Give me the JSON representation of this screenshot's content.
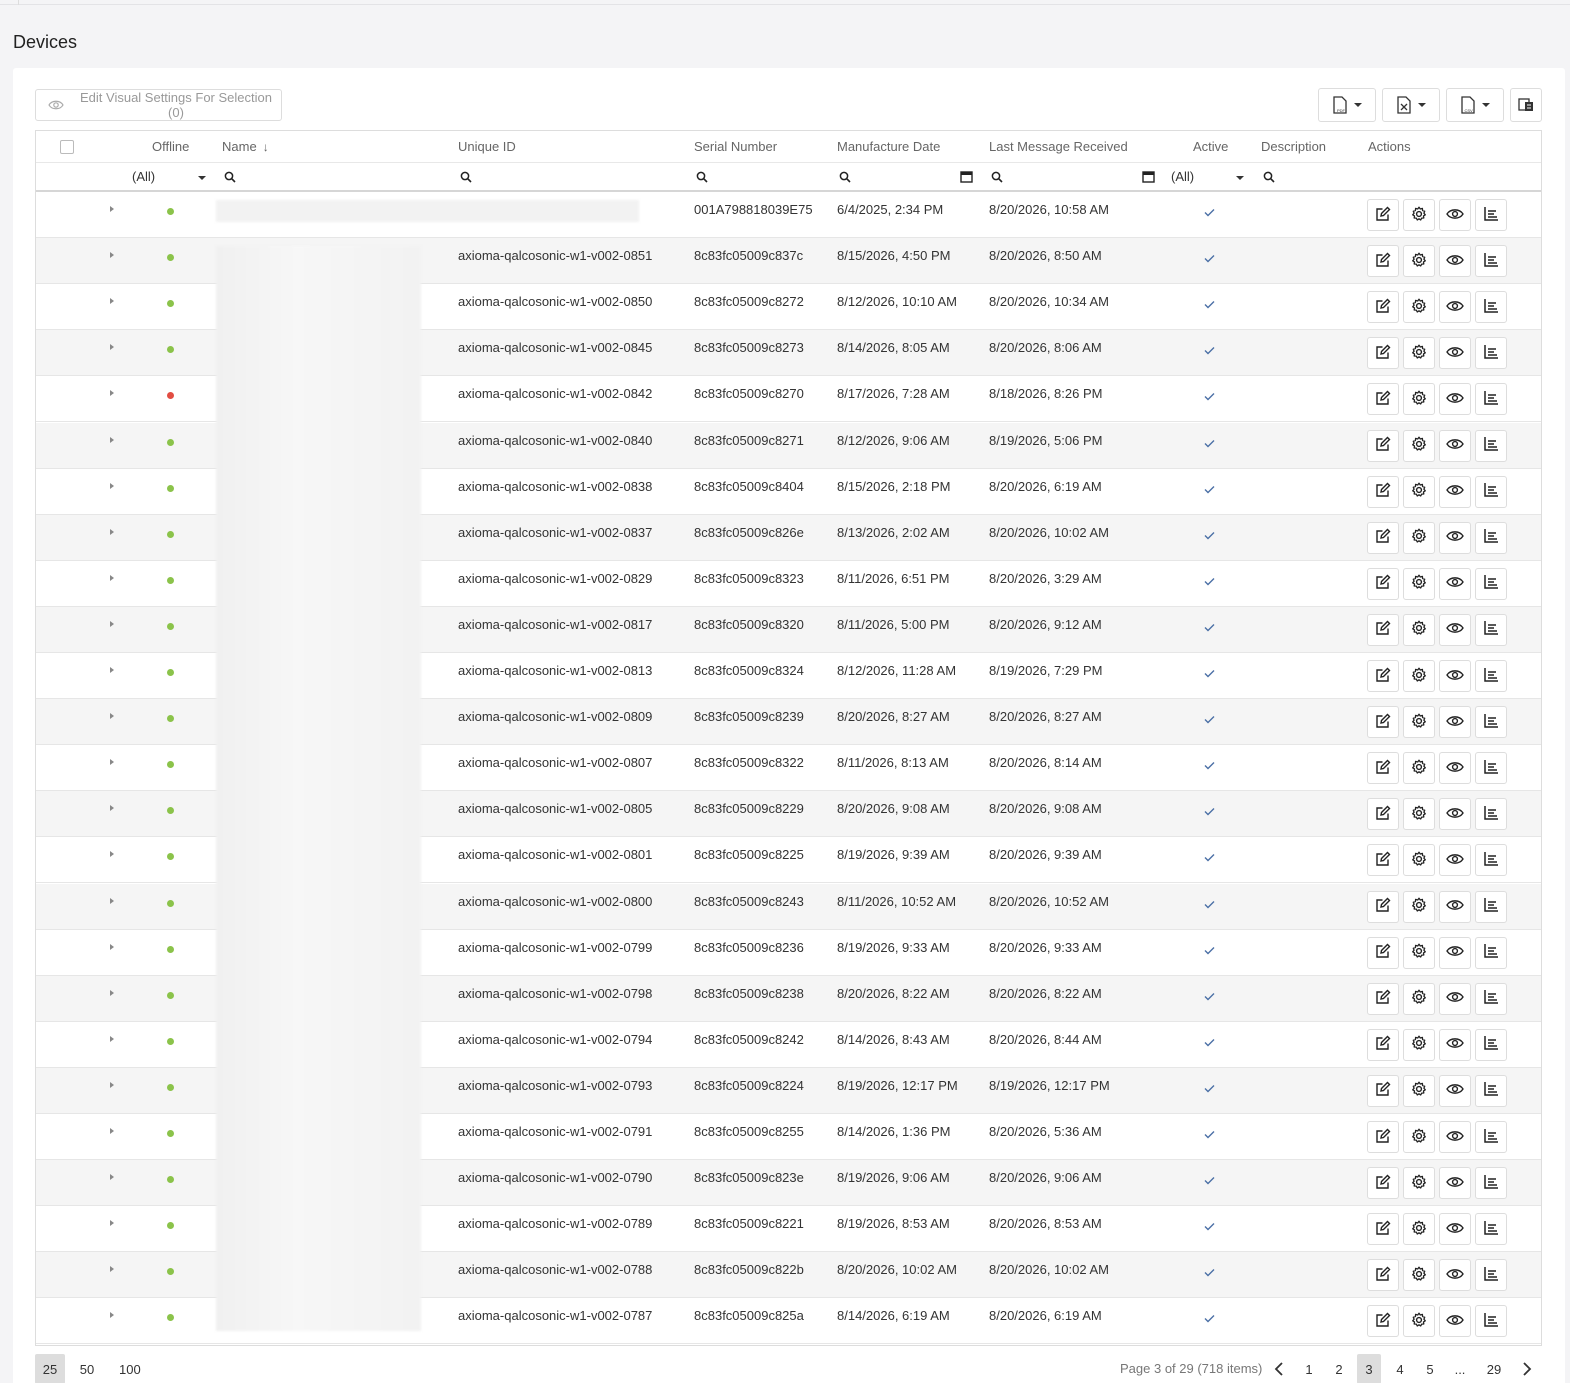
{
  "page": {
    "title": "Devices"
  },
  "toolbar": {
    "edit_visual_label": "Edit Visual Settings For Selection (0)",
    "export_pdf_icon": "pdf-file-icon",
    "export_excel_icon": "excel-file-icon",
    "export_csv_icon": "csv-file-icon",
    "column_chooser_icon": "column-chooser-icon"
  },
  "columns": {
    "offline": "Offline",
    "name": "Name",
    "unique_id": "Unique ID",
    "serial_number": "Serial Number",
    "manufacture_date": "Manufacture Date",
    "last_message": "Last Message Received",
    "active": "Active",
    "description": "Description",
    "actions": "Actions"
  },
  "filters": {
    "offline": "(All)",
    "active": "(All)"
  },
  "colors": {
    "online": "#8bc34a",
    "offline": "#e24d42"
  },
  "rows": [
    {
      "status": "online",
      "unique_id": "",
      "serial": "001A798818039E75",
      "manufactured": "6/4/2025, 2:34 PM",
      "last_message": "8/20/2026, 10:58 AM",
      "active": true
    },
    {
      "status": "online",
      "unique_id": "axioma-qalcosonic-w1-v002-0851",
      "serial": "8c83fc05009c837c",
      "manufactured": "8/15/2026, 4:50 PM",
      "last_message": "8/20/2026, 8:50 AM",
      "active": true
    },
    {
      "status": "online",
      "unique_id": "axioma-qalcosonic-w1-v002-0850",
      "serial": "8c83fc05009c8272",
      "manufactured": "8/12/2026, 10:10 AM",
      "last_message": "8/20/2026, 10:34 AM",
      "active": true
    },
    {
      "status": "online",
      "unique_id": "axioma-qalcosonic-w1-v002-0845",
      "serial": "8c83fc05009c8273",
      "manufactured": "8/14/2026, 8:05 AM",
      "last_message": "8/20/2026, 8:06 AM",
      "active": true
    },
    {
      "status": "offline",
      "unique_id": "axioma-qalcosonic-w1-v002-0842",
      "serial": "8c83fc05009c8270",
      "manufactured": "8/17/2026, 7:28 AM",
      "last_message": "8/18/2026, 8:26 PM",
      "active": true
    },
    {
      "status": "online",
      "unique_id": "axioma-qalcosonic-w1-v002-0840",
      "serial": "8c83fc05009c8271",
      "manufactured": "8/12/2026, 9:06 AM",
      "last_message": "8/19/2026, 5:06 PM",
      "active": true
    },
    {
      "status": "online",
      "unique_id": "axioma-qalcosonic-w1-v002-0838",
      "serial": "8c83fc05009c8404",
      "manufactured": "8/15/2026, 2:18 PM",
      "last_message": "8/20/2026, 6:19 AM",
      "active": true
    },
    {
      "status": "online",
      "unique_id": "axioma-qalcosonic-w1-v002-0837",
      "serial": "8c83fc05009c826e",
      "manufactured": "8/13/2026, 2:02 AM",
      "last_message": "8/20/2026, 10:02 AM",
      "active": true
    },
    {
      "status": "online",
      "unique_id": "axioma-qalcosonic-w1-v002-0829",
      "serial": "8c83fc05009c8323",
      "manufactured": "8/11/2026, 6:51 PM",
      "last_message": "8/20/2026, 3:29 AM",
      "active": true
    },
    {
      "status": "online",
      "unique_id": "axioma-qalcosonic-w1-v002-0817",
      "serial": "8c83fc05009c8320",
      "manufactured": "8/11/2026, 5:00 PM",
      "last_message": "8/20/2026, 9:12 AM",
      "active": true
    },
    {
      "status": "online",
      "unique_id": "axioma-qalcosonic-w1-v002-0813",
      "serial": "8c83fc05009c8324",
      "manufactured": "8/12/2026, 11:28 AM",
      "last_message": "8/19/2026, 7:29 PM",
      "active": true
    },
    {
      "status": "online",
      "unique_id": "axioma-qalcosonic-w1-v002-0809",
      "serial": "8c83fc05009c8239",
      "manufactured": "8/20/2026, 8:27 AM",
      "last_message": "8/20/2026, 8:27 AM",
      "active": true
    },
    {
      "status": "online",
      "unique_id": "axioma-qalcosonic-w1-v002-0807",
      "serial": "8c83fc05009c8322",
      "manufactured": "8/11/2026, 8:13 AM",
      "last_message": "8/20/2026, 8:14 AM",
      "active": true
    },
    {
      "status": "online",
      "unique_id": "axioma-qalcosonic-w1-v002-0805",
      "serial": "8c83fc05009c8229",
      "manufactured": "8/20/2026, 9:08 AM",
      "last_message": "8/20/2026, 9:08 AM",
      "active": true
    },
    {
      "status": "online",
      "unique_id": "axioma-qalcosonic-w1-v002-0801",
      "serial": "8c83fc05009c8225",
      "manufactured": "8/19/2026, 9:39 AM",
      "last_message": "8/20/2026, 9:39 AM",
      "active": true
    },
    {
      "status": "online",
      "unique_id": "axioma-qalcosonic-w1-v002-0800",
      "serial": "8c83fc05009c8243",
      "manufactured": "8/11/2026, 10:52 AM",
      "last_message": "8/20/2026, 10:52 AM",
      "active": true
    },
    {
      "status": "online",
      "unique_id": "axioma-qalcosonic-w1-v002-0799",
      "serial": "8c83fc05009c8236",
      "manufactured": "8/19/2026, 9:33 AM",
      "last_message": "8/20/2026, 9:33 AM",
      "active": true
    },
    {
      "status": "online",
      "unique_id": "axioma-qalcosonic-w1-v002-0798",
      "serial": "8c83fc05009c8238",
      "manufactured": "8/20/2026, 8:22 AM",
      "last_message": "8/20/2026, 8:22 AM",
      "active": true
    },
    {
      "status": "online",
      "unique_id": "axioma-qalcosonic-w1-v002-0794",
      "serial": "8c83fc05009c8242",
      "manufactured": "8/14/2026, 8:43 AM",
      "last_message": "8/20/2026, 8:44 AM",
      "active": true
    },
    {
      "status": "online",
      "unique_id": "axioma-qalcosonic-w1-v002-0793",
      "serial": "8c83fc05009c8224",
      "manufactured": "8/19/2026, 12:17 PM",
      "last_message": "8/19/2026, 12:17 PM",
      "active": true
    },
    {
      "status": "online",
      "unique_id": "axioma-qalcosonic-w1-v002-0791",
      "serial": "8c83fc05009c8255",
      "manufactured": "8/14/2026, 1:36 PM",
      "last_message": "8/20/2026, 5:36 AM",
      "active": true
    },
    {
      "status": "online",
      "unique_id": "axioma-qalcosonic-w1-v002-0790",
      "serial": "8c83fc05009c823e",
      "manufactured": "8/19/2026, 9:06 AM",
      "last_message": "8/20/2026, 9:06 AM",
      "active": true
    },
    {
      "status": "online",
      "unique_id": "axioma-qalcosonic-w1-v002-0789",
      "serial": "8c83fc05009c8221",
      "manufactured": "8/19/2026, 8:53 AM",
      "last_message": "8/20/2026, 8:53 AM",
      "active": true
    },
    {
      "status": "online",
      "unique_id": "axioma-qalcosonic-w1-v002-0788",
      "serial": "8c83fc05009c822b",
      "manufactured": "8/20/2026, 10:02 AM",
      "last_message": "8/20/2026, 10:02 AM",
      "active": true
    },
    {
      "status": "online",
      "unique_id": "axioma-qalcosonic-w1-v002-0787",
      "serial": "8c83fc05009c825a",
      "manufactured": "8/14/2026, 6:19 AM",
      "last_message": "8/20/2026, 6:19 AM",
      "active": true
    }
  ],
  "pager": {
    "sizes": [
      "25",
      "50",
      "100"
    ],
    "selected_size": "25",
    "info": "Page 3 of 29 (718 items)",
    "pages": [
      "1",
      "2",
      "3",
      "4",
      "5",
      "...",
      "29"
    ],
    "current_page": "3"
  }
}
